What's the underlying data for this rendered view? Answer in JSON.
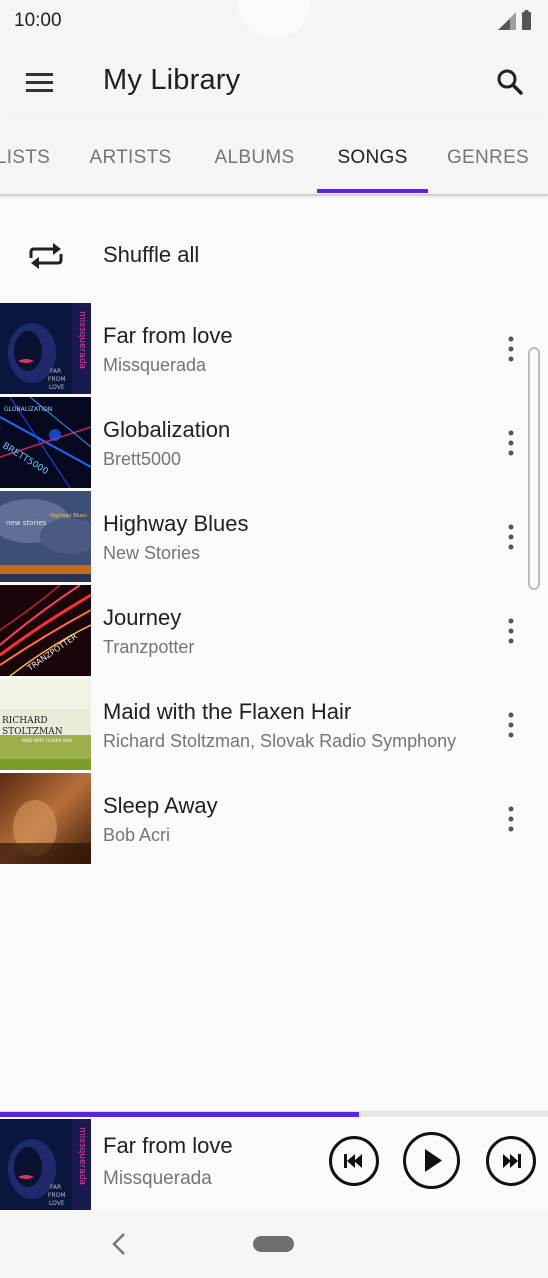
{
  "status_bar": {
    "time": "10:00"
  },
  "app_bar": {
    "title": "My Library",
    "menu_icon": "menu-icon",
    "search_icon": "search-icon"
  },
  "tabs": [
    {
      "label": "LISTS",
      "active": false
    },
    {
      "label": "ARTISTS",
      "active": false
    },
    {
      "label": "ALBUMS",
      "active": false
    },
    {
      "label": "SONGS",
      "active": true
    },
    {
      "label": "GENRES",
      "active": false
    }
  ],
  "shuffle": {
    "label": "Shuffle all",
    "icon": "shuffle-icon"
  },
  "songs": [
    {
      "title": "Far from love",
      "artist": "Missquerada"
    },
    {
      "title": "Globalization",
      "artist": "Brett5000"
    },
    {
      "title": "Highway Blues",
      "artist": "New Stories"
    },
    {
      "title": "Journey",
      "artist": "Tranzpotter"
    },
    {
      "title": "Maid with the Flaxen Hair",
      "artist": "Richard Stoltzman, Slovak Radio Symphony"
    },
    {
      "title": "Sleep Away",
      "artist": "Bob Acri"
    }
  ],
  "album_art_text": {
    "far_from_love": [
      "missquerada",
      "FAR",
      "FROM",
      "LOVE"
    ],
    "globalization": [
      "GLOBALIZATION",
      "BRETT5000"
    ],
    "highway_blues": [
      "new stories",
      "Highway Blues"
    ],
    "journey": [
      "TRANZPOTTER"
    ],
    "maid": [
      "RICHARD",
      "STOLTZMAN",
      "MAID WITH FLAXEN HAIR"
    ]
  },
  "now_playing": {
    "title": "Far from love",
    "artist": "Missquerada",
    "progress": 0.655
  },
  "colors": {
    "accent": "#5b23e3",
    "background": "#fafafa",
    "secondary_text": "#757575"
  }
}
